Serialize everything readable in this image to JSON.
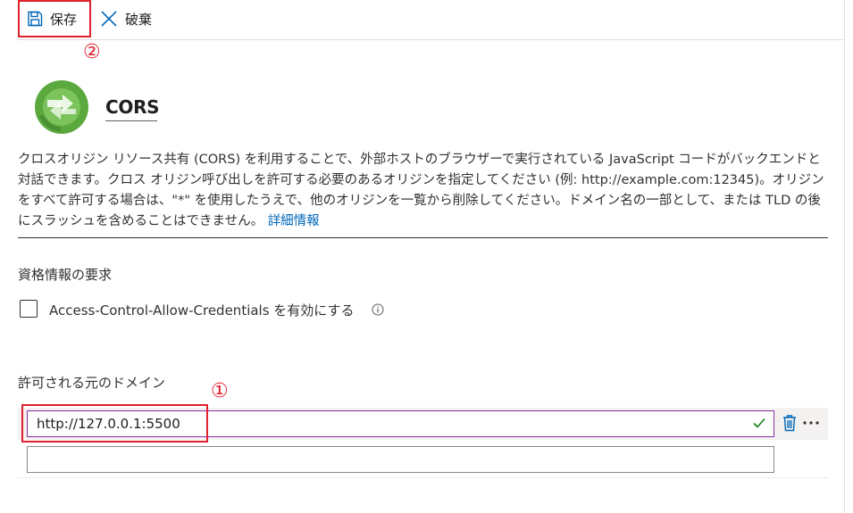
{
  "toolbar": {
    "save_label": "保存",
    "discard_label": "破棄",
    "save_icon": "floppy-disk-icon",
    "discard_icon": "close-icon"
  },
  "annotations": {
    "marker_1": "①",
    "marker_2": "②",
    "highlight_color": "#e0202c"
  },
  "header": {
    "title": "CORS",
    "logo_icon": "cors-logo-icon"
  },
  "description": {
    "text": "クロスオリジン リソース共有 (CORS) を利用することで、外部ホストのブラウザーで実行されている JavaScript コードがバックエンドと対話できます。クロス オリジン呼び出しを許可する必要のあるオリジンを指定してください (例: http://example.com:12345)。オリジンをすべて許可する場合は、\"*\" を使用したうえで、他のオリジンを一覧から削除してください。ドメイン名の一部として、または TLD の後にスラッシュを含めることはできません。",
    "link_text": "詳細情報",
    "link_color": "#0067b8"
  },
  "credentials": {
    "section_label": "資格情報の要求",
    "checkbox_label": "Access-Control-Allow-Credentials を有効にする",
    "checked": false,
    "info_icon": "info-icon"
  },
  "origins": {
    "section_label": "許可される元のドメイン",
    "items": [
      {
        "value": "http://127.0.0.1:5500",
        "valid": true
      }
    ],
    "new_item_value": "",
    "active_border_color": "#8a2da5",
    "valid_color": "#107c10"
  }
}
